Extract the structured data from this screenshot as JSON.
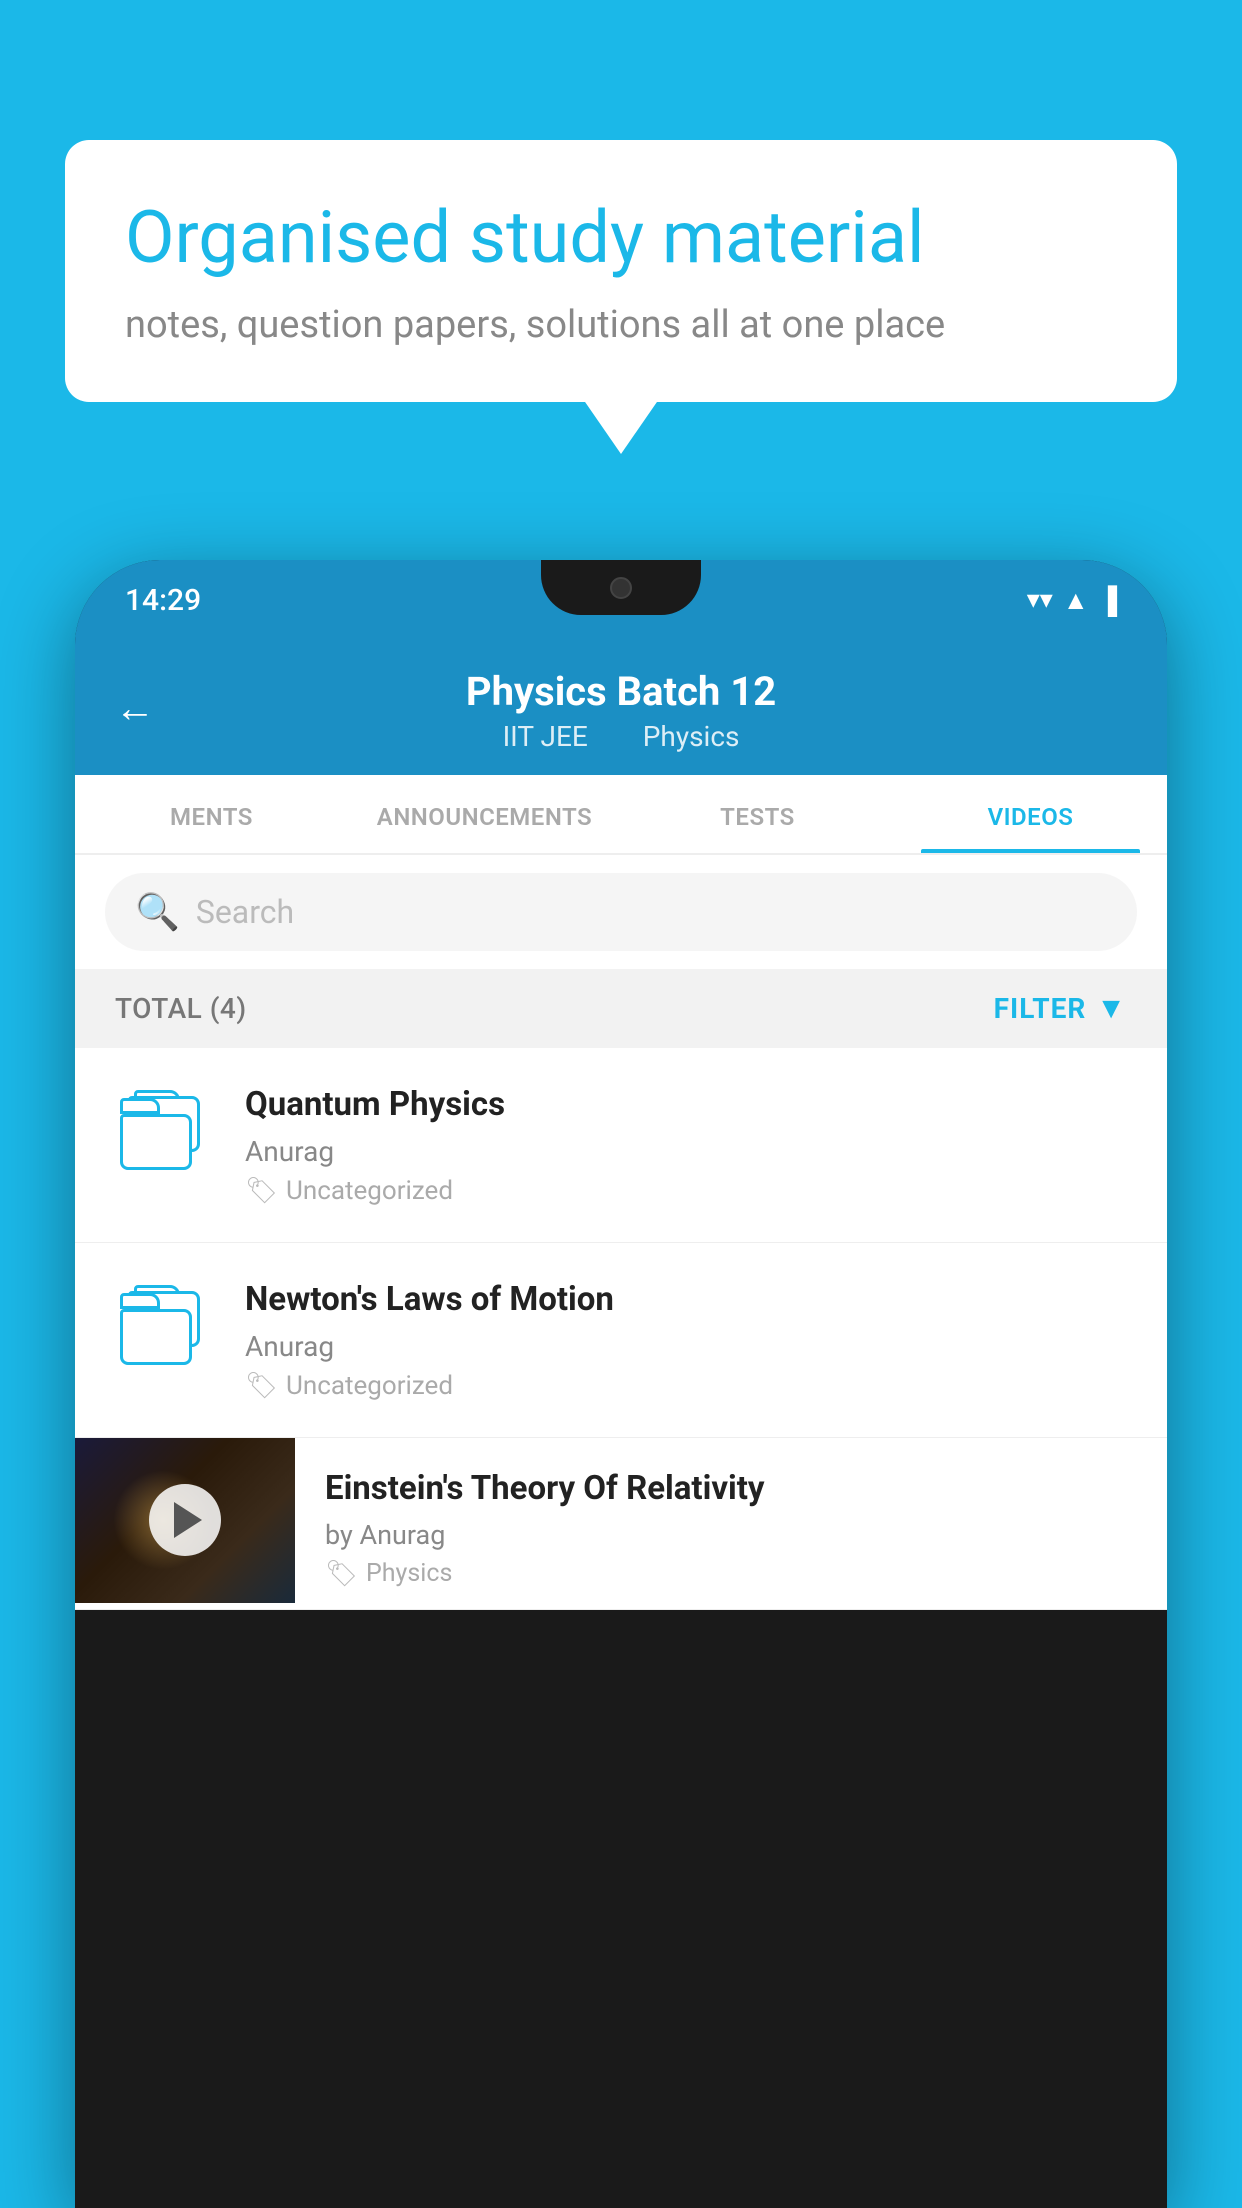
{
  "background": {
    "color": "#1bb8e8"
  },
  "bubble": {
    "title": "Organised study material",
    "subtitle": "notes, question papers, solutions all at one place"
  },
  "phone": {
    "time": "14:29",
    "header": {
      "title": "Physics Batch 12",
      "subtitle_left": "IIT JEE",
      "subtitle_right": "Physics"
    },
    "tabs": [
      {
        "label": "MENTS",
        "active": false
      },
      {
        "label": "ANNOUNCEMENTS",
        "active": false
      },
      {
        "label": "TESTS",
        "active": false
      },
      {
        "label": "VIDEOS",
        "active": true
      }
    ],
    "search": {
      "placeholder": "Search"
    },
    "filter": {
      "total_label": "TOTAL (4)",
      "button_label": "FILTER"
    },
    "videos": [
      {
        "title": "Quantum Physics",
        "author": "Anurag",
        "tag": "Uncategorized",
        "has_thumbnail": false
      },
      {
        "title": "Newton's Laws of Motion",
        "author": "Anurag",
        "tag": "Uncategorized",
        "has_thumbnail": false
      },
      {
        "title": "Einstein's Theory Of Relativity",
        "author": "by Anurag",
        "tag": "Physics",
        "has_thumbnail": true
      }
    ]
  }
}
